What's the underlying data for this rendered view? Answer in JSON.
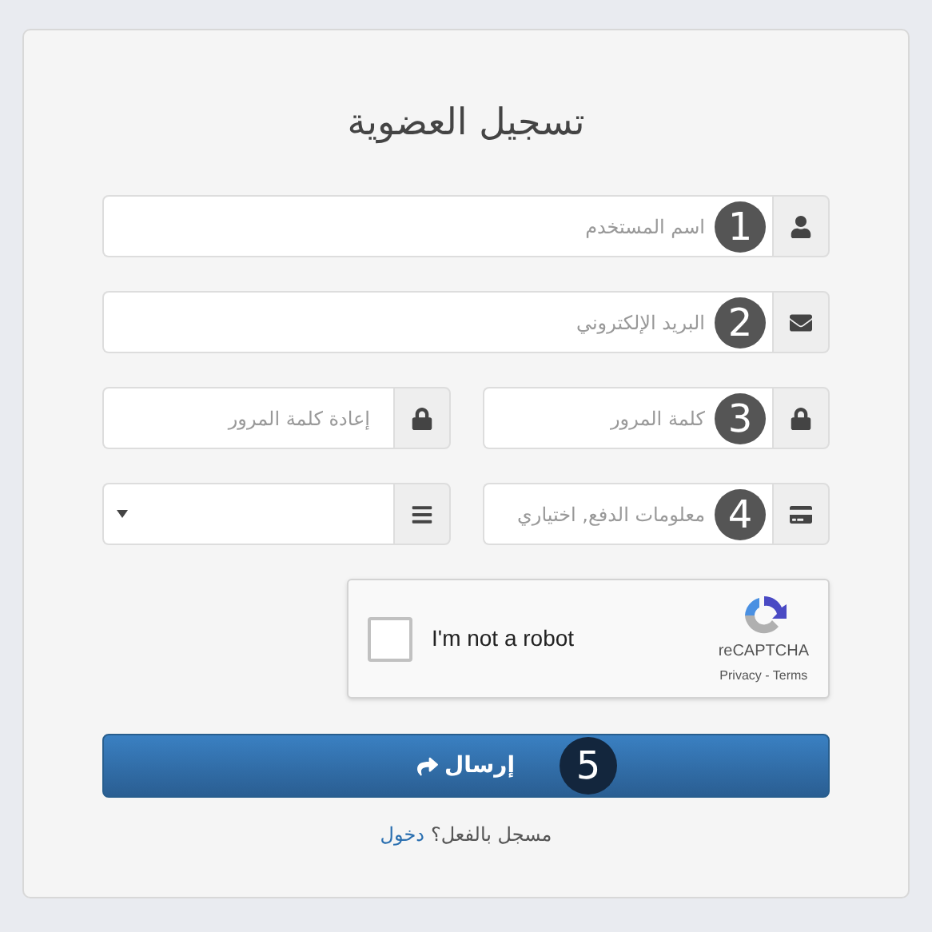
{
  "title": "تسجيل العضوية",
  "rows": [
    [
      {
        "kind": "text",
        "placeholder": "اسم المستخدم",
        "marker": "1"
      }
    ],
    [
      {
        "kind": "text",
        "placeholder": "البريد الإلكتروني",
        "marker": "2"
      }
    ],
    [
      {
        "kind": "text",
        "placeholder": "كلمة المرور",
        "marker": "3"
      },
      {
        "kind": "text",
        "placeholder": "إعادة كلمة المرور"
      }
    ],
    [
      {
        "kind": "text",
        "placeholder": "معلومات الدفع, اختياري",
        "marker": "4"
      },
      {
        "kind": "select"
      }
    ]
  ],
  "captcha": {
    "label": "I'm not a robot",
    "checked": false,
    "brand": "reCAPTCHA",
    "links": "Privacy - Terms"
  },
  "submit": {
    "label": "إرسال",
    "marker": "5"
  },
  "footer": {
    "text": "مسجل بالفعل؟",
    "link": "دخول"
  }
}
